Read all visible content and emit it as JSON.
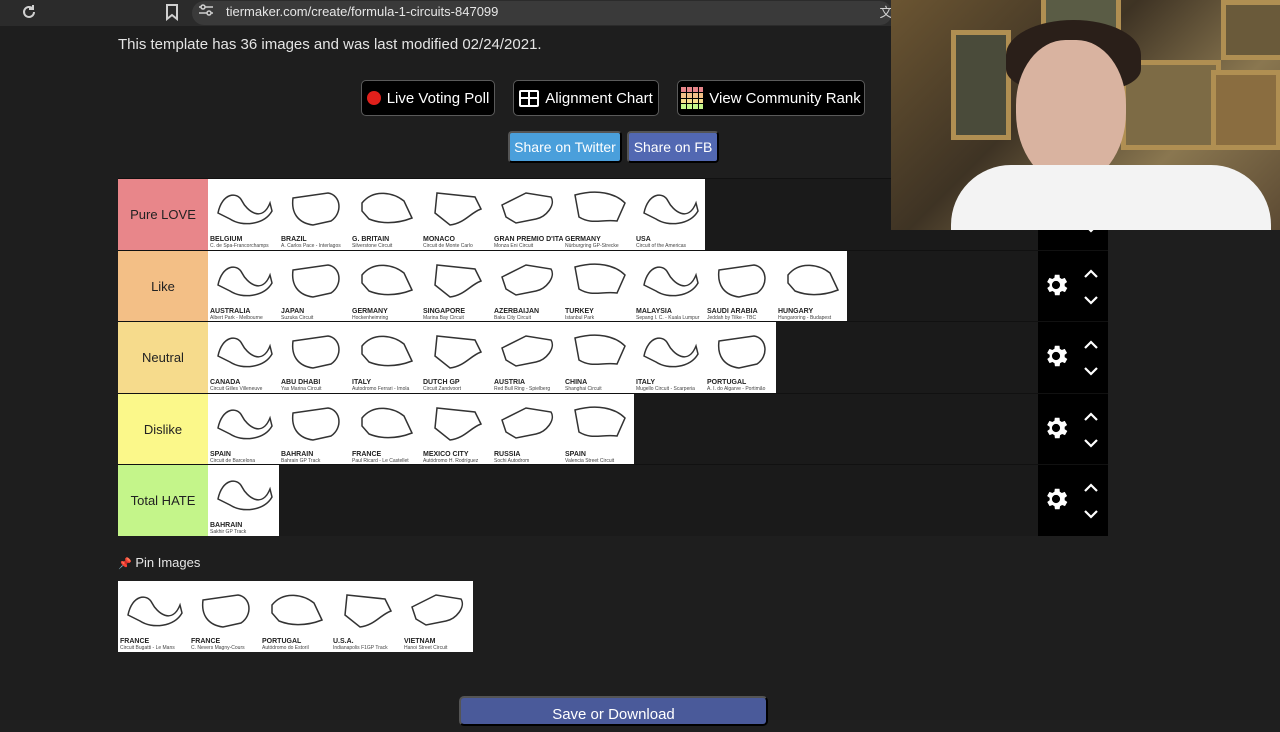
{
  "browser": {
    "url": "tiermaker.com/create/formula-1-circuits-847099",
    "translate_icon": "文"
  },
  "template_info": "This template has 36 images and was last modified 02/24/2021.",
  "buttons": {
    "live_voting": "Live Voting Poll",
    "alignment_chart": "Alignment Chart",
    "community_rank": "View Community Rank",
    "share_twitter": "Share on Twitter",
    "share_fb": "Share on FB",
    "save": "Save or Download"
  },
  "colors": {
    "pure_love": "#e8868a",
    "like": "#f3bf86",
    "neutral": "#f6db8c",
    "dislike": "#fbf88a",
    "total_hate": "#c4f58a",
    "twitter": "#4a9fdb",
    "fb": "#5268b2"
  },
  "tiers": [
    {
      "label": "Pure LOVE",
      "items": [
        {
          "name": "BELGIUM",
          "sub": "C. de Spa-Francorchamps"
        },
        {
          "name": "BRAZIL",
          "sub": "A. Carlos Pace - Interlagos"
        },
        {
          "name": "G. BRITAIN",
          "sub": "Silverstone Circuit"
        },
        {
          "name": "MONACO",
          "sub": "Circuit de Monte Carlo"
        },
        {
          "name": "GRAN PREMIO D'ITALIA",
          "sub": "Monza Eni Circuit"
        },
        {
          "name": "GERMANY",
          "sub": "Nürburgring GP-Strecke"
        },
        {
          "name": "USA",
          "sub": "Circuit of the Americas"
        }
      ]
    },
    {
      "label": "Like",
      "items": [
        {
          "name": "AUSTRALIA",
          "sub": "Albert Park - Melbourne"
        },
        {
          "name": "JAPAN",
          "sub": "Suzuka Circuit"
        },
        {
          "name": "GERMANY",
          "sub": "Hockenheimring"
        },
        {
          "name": "SINGAPORE",
          "sub": "Marina Bay Circuit"
        },
        {
          "name": "AZERBAIJAN",
          "sub": "Baku City Circuit"
        },
        {
          "name": "TURKEY",
          "sub": "Istanbul Park"
        },
        {
          "name": "MALAYSIA",
          "sub": "Sepang I. C. - Kuala Lumpur"
        },
        {
          "name": "SAUDI ARABIA",
          "sub": "Jeddah by Tilke - TBC"
        },
        {
          "name": "HUNGARY",
          "sub": "Hungaroring - Budapest"
        }
      ]
    },
    {
      "label": "Neutral",
      "items": [
        {
          "name": "CANADA",
          "sub": "Circuit Gilles Villeneuve"
        },
        {
          "name": "ABU DHABI",
          "sub": "Yas Marina Circuit"
        },
        {
          "name": "ITALY",
          "sub": "Autodromo Ferrari - Imola"
        },
        {
          "name": "DUTCH GP",
          "sub": "Circuit Zandvoort"
        },
        {
          "name": "AUSTRIA",
          "sub": "Red Bull Ring - Spielberg"
        },
        {
          "name": "CHINA",
          "sub": "Shanghai Circuit"
        },
        {
          "name": "ITALY",
          "sub": "Mugello Circuit - Scarperia"
        },
        {
          "name": "PORTUGAL",
          "sub": "A. I. do Algarve - Portimão"
        }
      ]
    },
    {
      "label": "Dislike",
      "items": [
        {
          "name": "SPAIN",
          "sub": "Circuit de Barcelona"
        },
        {
          "name": "BAHRAIN",
          "sub": "Bahrain GP Track"
        },
        {
          "name": "FRANCE",
          "sub": "Paul Ricard - Le Castellet"
        },
        {
          "name": "MEXICO CITY",
          "sub": "Autódromo H. Rodríguez"
        },
        {
          "name": "RUSSIA",
          "sub": "Sochi Autodrom"
        },
        {
          "name": "SPAIN",
          "sub": "Valencia Street Circuit"
        }
      ]
    },
    {
      "label": "Total HATE",
      "items": [
        {
          "name": "BAHRAIN",
          "sub": "Sakhir GP Track"
        }
      ]
    }
  ],
  "pin": {
    "title": "Pin Images",
    "icon": "📌",
    "items": [
      {
        "name": "FRANCE",
        "sub": "Circuit Bugatti - Le Mans"
      },
      {
        "name": "FRANCE",
        "sub": "C. Nevers Magny-Cours"
      },
      {
        "name": "PORTUGAL",
        "sub": "Autódromo do Estoril"
      },
      {
        "name": "U.S.A.",
        "sub": "Indianapolis F1GP Track"
      },
      {
        "name": "VIETNAM",
        "sub": "Hanoi Street Circuit"
      }
    ]
  }
}
